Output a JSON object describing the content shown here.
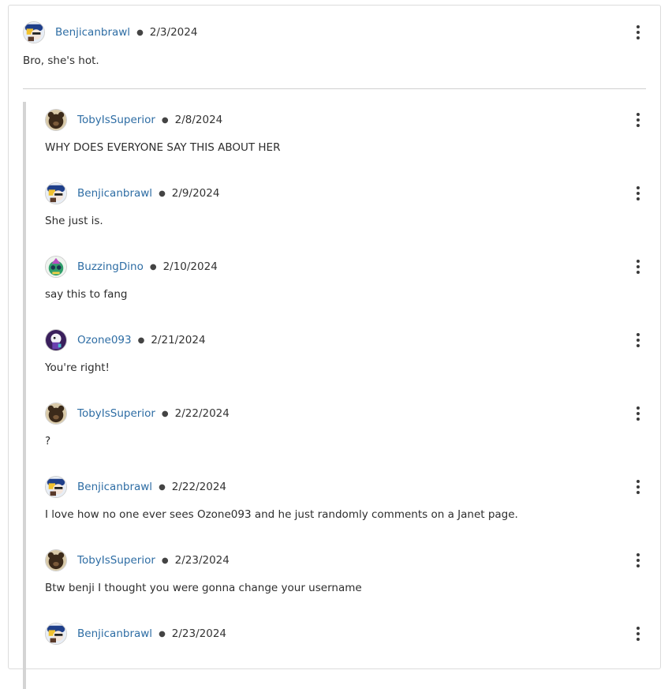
{
  "top_comment": {
    "user": "Benjicanbrawl",
    "avatar_icon": "benjicanbrawl-avatar-icon",
    "date": "2/3/2024",
    "text": "Bro, she's hot."
  },
  "replies": [
    {
      "user": "TobyIsSuperior",
      "avatar_icon": "tobyissuperior-avatar-icon",
      "date": "2/8/2024",
      "text": "WHY DOES EVERYONE SAY THIS ABOUT HER"
    },
    {
      "user": "Benjicanbrawl",
      "avatar_icon": "benjicanbrawl-avatar-icon",
      "date": "2/9/2024",
      "text": "She just is."
    },
    {
      "user": "BuzzingDino",
      "avatar_icon": "buzzingdino-avatar-icon",
      "date": "2/10/2024",
      "text": "say this to fang"
    },
    {
      "user": "Ozone093",
      "avatar_icon": "ozone093-avatar-icon",
      "date": "2/21/2024",
      "text": "You're right!"
    },
    {
      "user": "TobyIsSuperior",
      "avatar_icon": "tobyissuperior-avatar-icon",
      "date": "2/22/2024",
      "text": "?"
    },
    {
      "user": "Benjicanbrawl",
      "avatar_icon": "benjicanbrawl-avatar-icon",
      "date": "2/22/2024",
      "text": "I love how no one ever sees Ozone093 and he just randomly comments on a Janet page."
    },
    {
      "user": "TobyIsSuperior",
      "avatar_icon": "tobyissuperior-avatar-icon",
      "date": "2/23/2024",
      "text": "Btw benji I thought you were gonna change your username"
    },
    {
      "user": "Benjicanbrawl",
      "avatar_icon": "benjicanbrawl-avatar-icon",
      "date": "2/23/2024",
      "text": ""
    }
  ],
  "colors": {
    "username": "#2e6da4",
    "thread_line": "#d4d4d4",
    "border": "#dcdcdc"
  }
}
